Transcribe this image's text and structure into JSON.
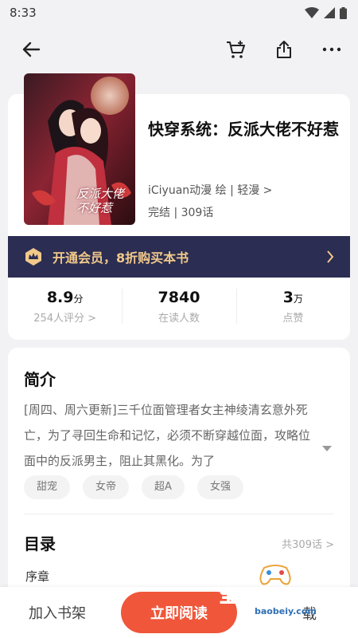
{
  "status_bar": {
    "time": "8:33"
  },
  "book": {
    "title": "快穿系统：反派大佬不好惹",
    "author": "iCiyuan动漫 绘 | 轻漫 >",
    "status": "完结 | 309话",
    "cover_text": "反派大佬不好惹"
  },
  "vip": {
    "label": "开通会员，8折购买本书"
  },
  "stats": [
    {
      "value": "8.9",
      "unit": "分",
      "label": "254人评分 >"
    },
    {
      "value": "7840",
      "unit": "",
      "label": "在读人数"
    },
    {
      "value": "3",
      "unit": "万",
      "label": "点赞"
    }
  ],
  "intro": {
    "title": "简介",
    "text": "[周四、周六更新]三千位面管理者女主神绫清玄意外死亡，为了寻回生命和记忆，必须不断穿越位面，攻略位面中的反派男主，阻止其黑化。为了"
  },
  "tags": [
    "甜宠",
    "女帝",
    "超A",
    "女强"
  ],
  "toc": {
    "title": "目录",
    "count": "共309话 >",
    "first_chapter": "序章"
  },
  "bottom": {
    "shelf": "加入书架",
    "read": "立即阅读",
    "download": "载"
  },
  "watermark": {
    "text": "宝贝游戏网",
    "url": "baobeiy.com"
  },
  "colors": {
    "accent": "#f0563a",
    "vip_bg": "#2b2d52",
    "vip_text": "#f2c98a"
  }
}
